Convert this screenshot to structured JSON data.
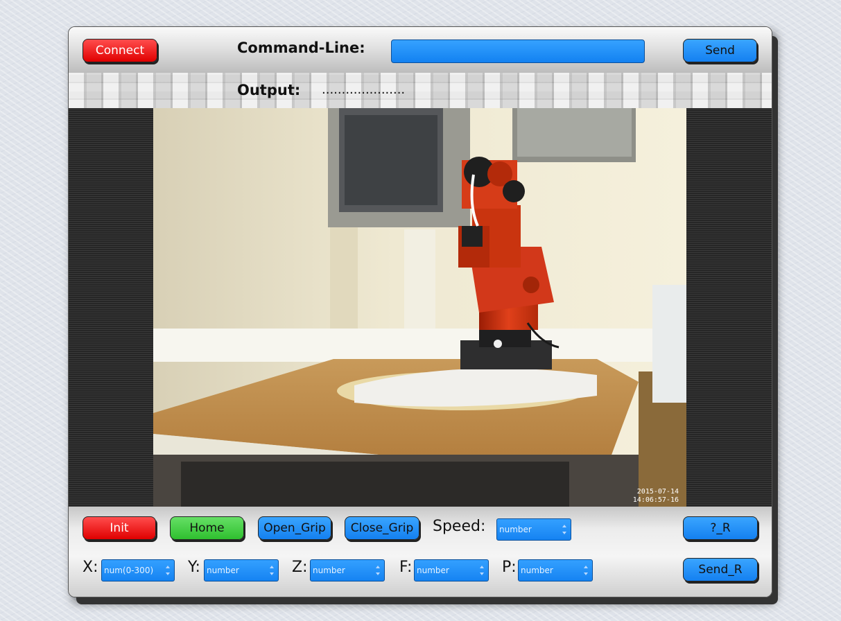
{
  "toolbar": {
    "connect_label": "Connect",
    "command_line_label": "Command-Line:",
    "command_value": "",
    "send_label": "Send"
  },
  "output": {
    "label": "Output:",
    "value": "....................."
  },
  "video": {
    "timestamp_date": "2015-07-14",
    "timestamp_time": "14:06:57-16"
  },
  "controls": {
    "init_label": "Init",
    "home_label": "Home",
    "open_grip_label": "Open_Grip",
    "close_grip_label": "Close_Grip",
    "speed_label": "Speed:",
    "speed_placeholder": "number",
    "query_r_label": "?_R",
    "send_r_label": "Send_R",
    "x_label": "X:",
    "x_placeholder": "num(0-300)",
    "y_label": "Y:",
    "y_placeholder": "number",
    "z_label": "Z:",
    "z_placeholder": "number",
    "f_label": "F:",
    "f_placeholder": "number",
    "p_label": "P:",
    "p_placeholder": "number"
  },
  "colors": {
    "connect": "#e00000",
    "init": "#e00000",
    "home": "#2fbf2f",
    "blue_button": "#1480f0",
    "input_field": "#1281f1"
  }
}
